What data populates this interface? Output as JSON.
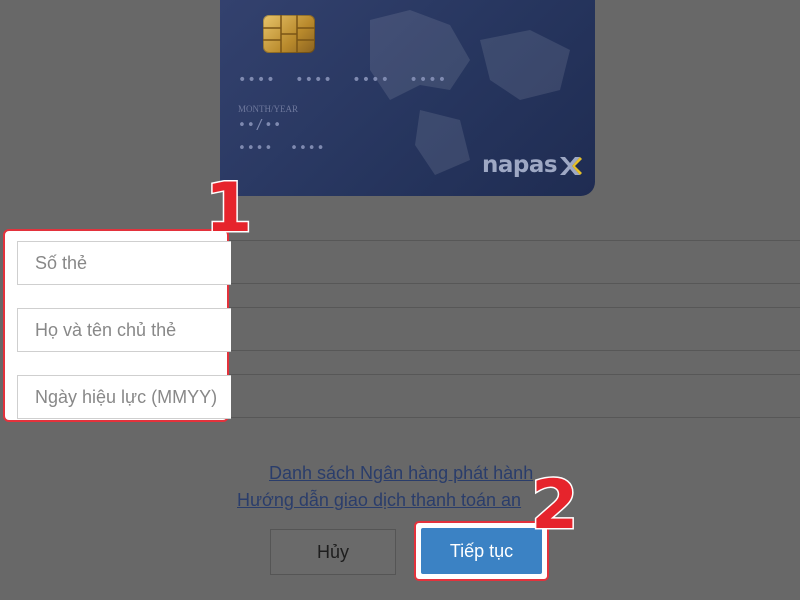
{
  "card": {
    "number_mask": "•••• •••• •••• ••••",
    "expiry_caption": "MONTH/YEAR",
    "expiry_mask": "••/••",
    "extra_mask": "•••• ••••",
    "brand": "napas"
  },
  "form": {
    "card_number_placeholder": "Số thẻ",
    "holder_name_placeholder": "Họ và tên chủ thẻ",
    "valid_date_placeholder": "Ngày hiệu lực (MMYY)"
  },
  "steps": {
    "one": "1",
    "two": "2"
  },
  "links": {
    "issuing_banks": "Danh sách Ngân hàng phát hành",
    "payment_guide": "Hướng dẫn giao dịch thanh toán an"
  },
  "buttons": {
    "cancel": "Hủy",
    "next": "Tiếp tục"
  },
  "colors": {
    "accent": "#3b82c4",
    "highlight": "#e3323c",
    "card": "#27365f"
  }
}
